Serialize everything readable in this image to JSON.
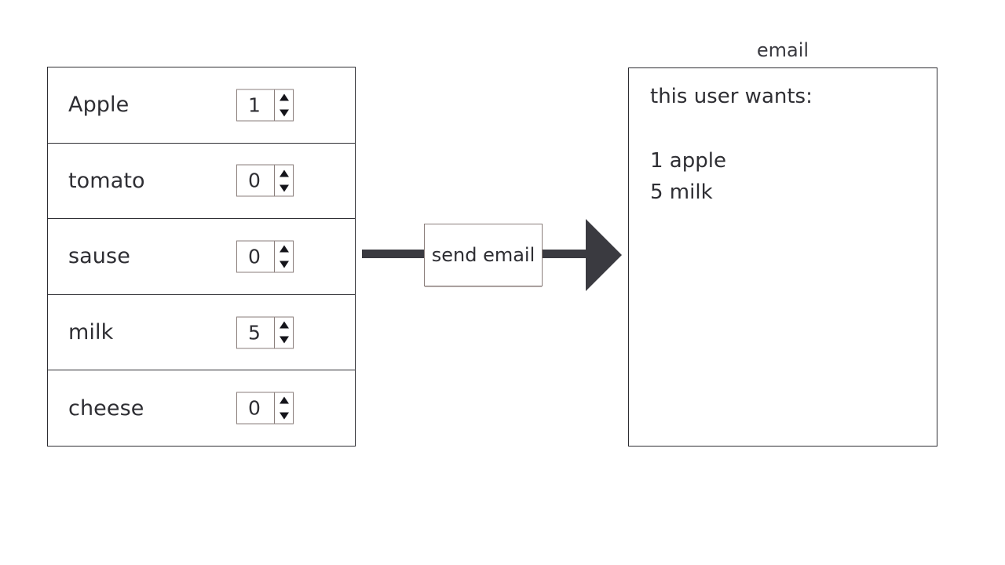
{
  "items_panel": {
    "rows": [
      {
        "label": "Apple",
        "value": "1",
        "increment_icon": "triangle-up-icon",
        "decrement_icon": "triangle-down-icon"
      },
      {
        "label": "tomato",
        "value": "0",
        "increment_icon": "triangle-up-icon",
        "decrement_icon": "triangle-down-icon"
      },
      {
        "label": "sause",
        "value": "0",
        "increment_icon": "triangle-up-icon",
        "decrement_icon": "triangle-down-icon"
      },
      {
        "label": "milk",
        "value": "5",
        "increment_icon": "triangle-up-icon",
        "decrement_icon": "triangle-down-icon"
      },
      {
        "label": "cheese",
        "value": "0",
        "increment_icon": "triangle-up-icon",
        "decrement_icon": "triangle-down-icon"
      }
    ]
  },
  "connector": {
    "button_label": "send email",
    "arrow_icon": "arrow-right-icon"
  },
  "email_panel": {
    "caption": "email",
    "heading": "this user wants:",
    "lines": [
      "1 apple",
      "5 milk"
    ]
  },
  "colors": {
    "ink": "#2e2e33",
    "arrow": "#3a3a40",
    "spinner_border": "#8a7e7b",
    "background": "#ffffff"
  }
}
